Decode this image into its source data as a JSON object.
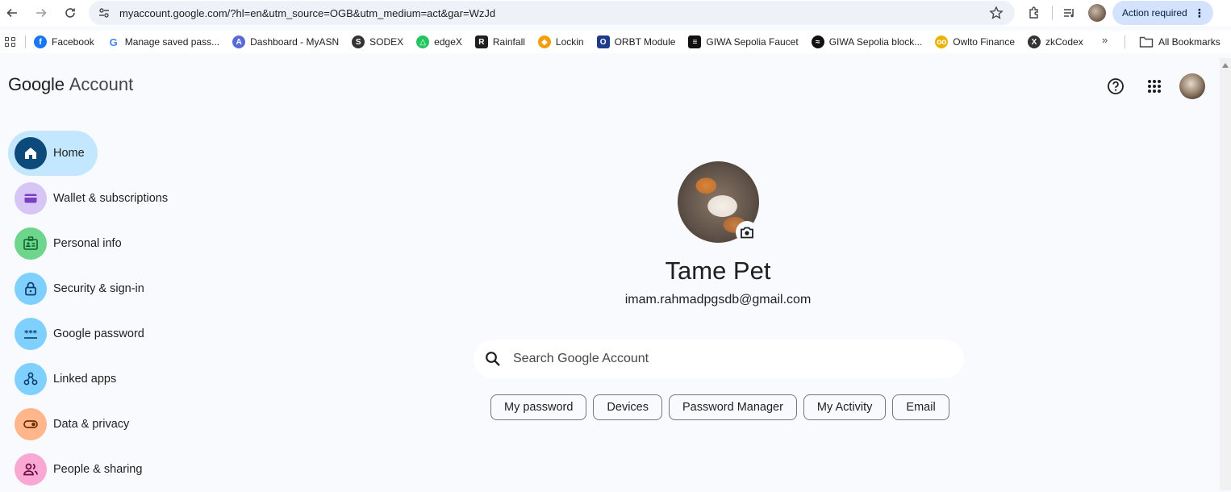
{
  "browser": {
    "url": "myaccount.google.com/?hl=en&utm_source=OGB&utm_medium=act&gar=WzJd",
    "action_required": "Action required",
    "icons": [
      "back-icon",
      "forward-icon",
      "reload-icon",
      "site-settings-icon",
      "star-icon",
      "extensions-icon",
      "media-icon",
      "profile-avatar",
      "kebab-icon"
    ]
  },
  "bookmarks": {
    "items": [
      {
        "label": "Facebook",
        "icon": "facebook-icon",
        "color": "#1877f2",
        "glyph": "f"
      },
      {
        "label": "Manage saved pass...",
        "icon": "google-icon",
        "color": "#4285f4",
        "glyph": "G"
      },
      {
        "label": "Dashboard - MyASN",
        "icon": "myasn-icon",
        "color": "#5b6bd6",
        "glyph": "A"
      },
      {
        "label": "SODEX",
        "icon": "sodex-icon",
        "color": "#333333",
        "glyph": "S"
      },
      {
        "label": "edgeX",
        "icon": "edgex-icon",
        "color": "#22c55e",
        "glyph": "△"
      },
      {
        "label": "Rainfall",
        "icon": "rainfall-icon",
        "color": "#1f1f1f",
        "glyph": "R"
      },
      {
        "label": "Lockin",
        "icon": "lockin-icon",
        "color": "#f59e0b",
        "glyph": "◆"
      },
      {
        "label": "ORBT Module",
        "icon": "orbt-icon",
        "color": "#1e3a8a",
        "glyph": "O"
      },
      {
        "label": "GIWA Sepolia Faucet",
        "icon": "giwa-faucet-icon",
        "color": "#111111",
        "glyph": "≡"
      },
      {
        "label": "GIWA Sepolia block...",
        "icon": "giwa-block-icon",
        "color": "#111111",
        "glyph": "≈"
      },
      {
        "label": "Owlto Finance",
        "icon": "owlto-icon",
        "color": "#eab308",
        "glyph": "oo"
      },
      {
        "label": "zkCodex",
        "icon": "zkcodex-icon",
        "color": "#333333",
        "glyph": "X"
      }
    ],
    "more": "»",
    "all_bookmarks": "All Bookmarks"
  },
  "header": {
    "brand_google": "Google",
    "brand_account": "Account"
  },
  "sidebar": {
    "items": [
      {
        "label": "Home",
        "icon": "home-icon",
        "color": "#0b57d0"
      },
      {
        "label": "Wallet & subscriptions",
        "icon": "wallet-icon",
        "color": "#d7c6f5"
      },
      {
        "label": "Personal info",
        "icon": "id-card-icon",
        "color": "#6dd58c"
      },
      {
        "label": "Security & sign-in",
        "icon": "lock-icon",
        "color": "#7fcfff"
      },
      {
        "label": "Google password",
        "icon": "password-icon",
        "color": "#7fcfff"
      },
      {
        "label": "Linked apps",
        "icon": "linked-apps-icon",
        "color": "#7fcfff"
      },
      {
        "label": "Data & privacy",
        "icon": "toggle-icon",
        "color": "#ffb68a"
      },
      {
        "label": "People & sharing",
        "icon": "people-icon",
        "color": "#f9a8d4"
      }
    ]
  },
  "profile": {
    "name": "Tame Pet",
    "email": "imam.rahmadpgsdb@gmail.com"
  },
  "search": {
    "placeholder": "Search Google Account"
  },
  "chips": [
    {
      "label": "My password"
    },
    {
      "label": "Devices"
    },
    {
      "label": "Password Manager"
    },
    {
      "label": "My Activity"
    },
    {
      "label": "Email"
    }
  ]
}
